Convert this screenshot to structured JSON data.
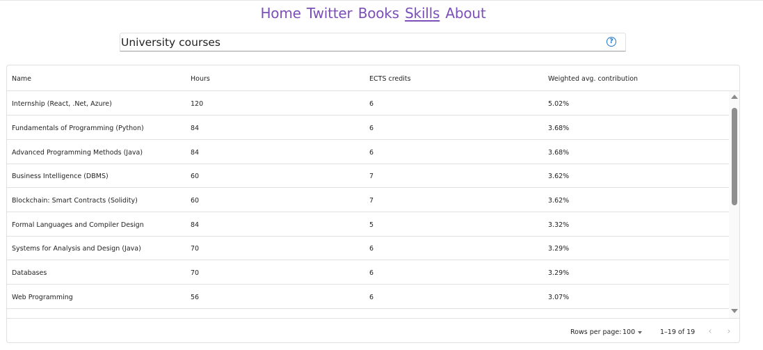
{
  "nav": {
    "items": [
      {
        "label": "Home"
      },
      {
        "label": "Twitter"
      },
      {
        "label": "Books"
      },
      {
        "label": "Skills"
      },
      {
        "label": "About"
      }
    ],
    "active": "Skills"
  },
  "search": {
    "value": "University courses",
    "help_icon": "help-circle-icon",
    "help_glyph": "?"
  },
  "table": {
    "columns": [
      "Name",
      "Hours",
      "ECTS credits",
      "Weighted avg. contribution"
    ],
    "rows": [
      [
        "Internship (React, .Net, Azure)",
        "120",
        "6",
        "5.02%"
      ],
      [
        "Fundamentals of Programming (Python)",
        "84",
        "6",
        "3.68%"
      ],
      [
        "Advanced Programming Methods (Java)",
        "84",
        "6",
        "3.68%"
      ],
      [
        "Business Intelligence (DBMS)",
        "60",
        "7",
        "3.62%"
      ],
      [
        "Blockchain: Smart Contracts (Solidity)",
        "60",
        "7",
        "3.62%"
      ],
      [
        "Formal Languages and Compiler Design",
        "84",
        "5",
        "3.32%"
      ],
      [
        "Systems for Analysis and Design (Java)",
        "70",
        "6",
        "3.29%"
      ],
      [
        "Databases",
        "70",
        "6",
        "3.29%"
      ],
      [
        "Web Programming",
        "56",
        "6",
        "3.07%"
      ]
    ]
  },
  "footer": {
    "rows_per_page_label": "Rows per page:",
    "rows_per_page_value": "100",
    "range_text": "1–19 of 19",
    "prev_glyph": "‹",
    "next_glyph": "›"
  },
  "colors": {
    "nav_link": "#7b4fb8",
    "help_icon": "#1976d2",
    "border": "#e0e0e0"
  }
}
